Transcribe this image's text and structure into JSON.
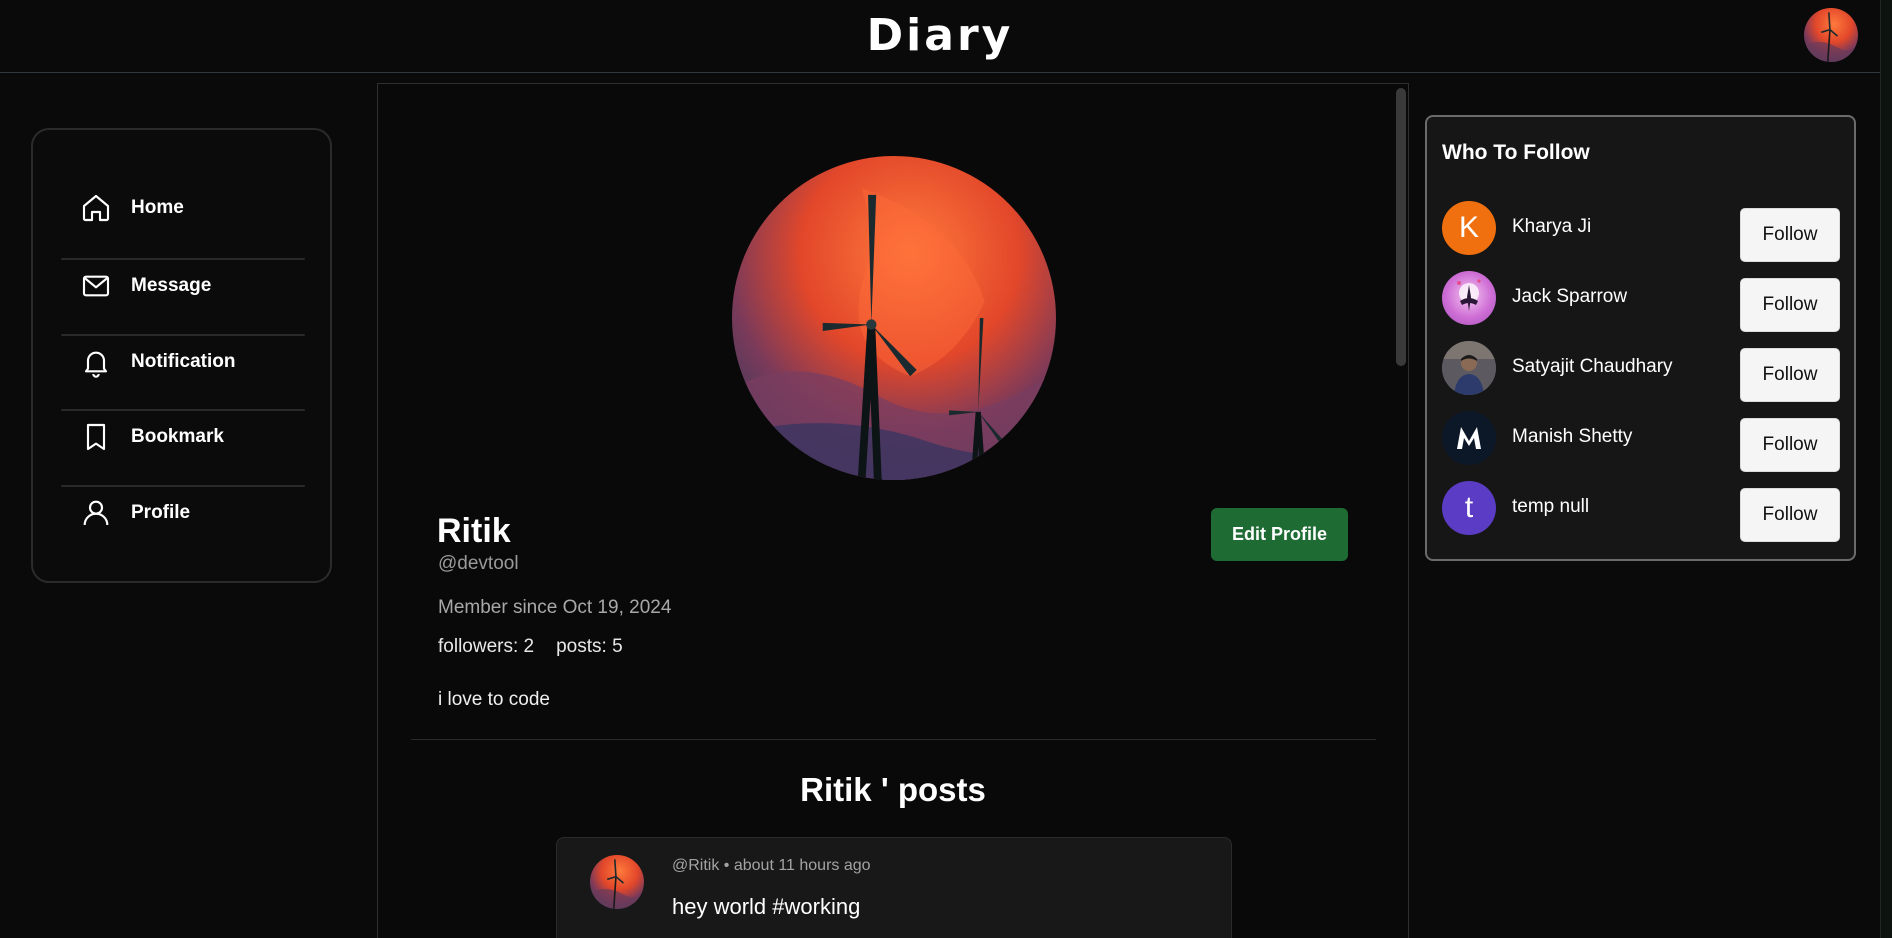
{
  "header": {
    "title": "Diary",
    "avatar_icon": "user-avatar"
  },
  "sidebar": {
    "items": [
      {
        "label": "Home",
        "icon": "home-icon"
      },
      {
        "label": "Message",
        "icon": "mail-icon"
      },
      {
        "label": "Notification",
        "icon": "bell-icon"
      },
      {
        "label": "Bookmark",
        "icon": "bookmark-icon"
      },
      {
        "label": "Profile",
        "icon": "user-icon"
      }
    ]
  },
  "profile": {
    "name": "Ritik",
    "handle": "@devtool",
    "member_since": "Member since Oct 19, 2024",
    "followers": "followers: 2",
    "posts": "posts: 5",
    "bio": "i love to code",
    "edit_label": "Edit Profile",
    "posts_heading": "Ritik ' posts"
  },
  "post": {
    "meta": "@Ritik • about 11 hours ago",
    "text": "hey world #working"
  },
  "who_to_follow": {
    "title": "Who To Follow",
    "follow_label": "Follow",
    "users": [
      {
        "name": "Kharya Ji",
        "initial": "K",
        "color": "#f0700f"
      },
      {
        "name": "Jack Sparrow",
        "initial": "",
        "color": "#c977d9"
      },
      {
        "name": "Satyajit Chaudhary",
        "initial": "",
        "color": "#3a3a4a"
      },
      {
        "name": "Manish Shetty",
        "initial": "",
        "color": "#0c1828"
      },
      {
        "name": "temp null",
        "initial": "t",
        "color": "#5b3cc4"
      }
    ]
  },
  "colors": {
    "accent_green": "#1e6b33",
    "background": "#0a0a0a"
  }
}
